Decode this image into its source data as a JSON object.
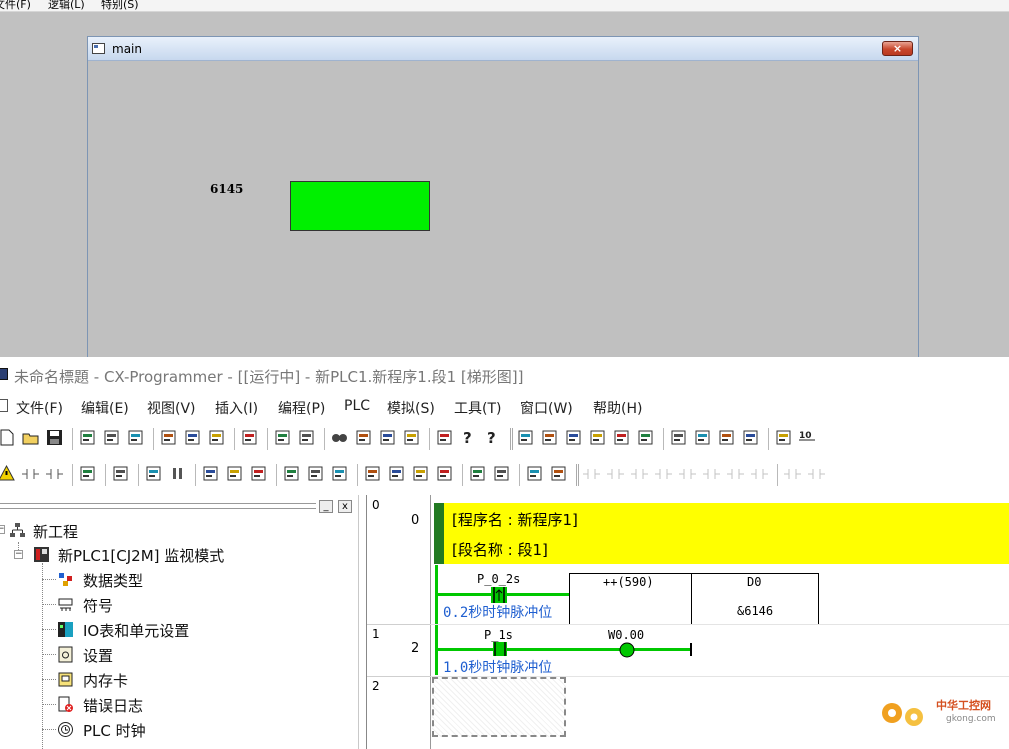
{
  "top_app": {
    "menu": [
      "文件(F)",
      "逻辑(L)",
      "特别(S)"
    ],
    "window_title": "main",
    "close_label": "×",
    "value_label": "6145",
    "indicator_color": "#00f000"
  },
  "cx": {
    "title": "未命名標題 - CX-Programmer - [[运行中] - 新PLC1.新程序1.段1 [梯形图]]",
    "menu": [
      "文件(F)",
      "编辑(E)",
      "视图(V)",
      "插入(I)",
      "编程(P)",
      "PLC",
      "模拟(S)",
      "工具(T)",
      "窗口(W)",
      "帮助(H)"
    ],
    "toolbar1_icons": [
      "new-icon",
      "open-icon",
      "save-icon",
      "print-preview-icon",
      "print-icon",
      "preview-icon",
      "cut-icon",
      "copy-icon",
      "paste-icon",
      "paste-special-icon",
      "undo-icon",
      "redo-icon",
      "find-icon",
      "replace-icon",
      "cross-ref-icon",
      "address-icon",
      "properties-icon",
      "help-icon",
      "context-help-icon",
      "ladder-view-icon",
      "mnemonic-view-icon",
      "monitor-icon",
      "watch-icon",
      "io-table-icon",
      "settings-icon",
      "symbol-table-icon",
      "program-icon",
      "function-block-icon",
      "memory-icon",
      "grid-icon",
      "radix-icon"
    ],
    "toolbar2_icons": [
      "warning-online-icon",
      "online-icon",
      "online-sim-icon",
      "transfer-icon",
      "monitor-mode-icon",
      "run-icon",
      "pause-icon",
      "upload-icon",
      "download-icon",
      "compare-icon",
      "force-on-icon",
      "force-off-icon",
      "force-cancel-icon",
      "screen-monitor-icon",
      "time-chart-icon",
      "data-trace-icon",
      "data-trace2-icon",
      "plc-info-icon",
      "cycle-time-icon",
      "sim-start-icon",
      "sim-stop-icon",
      "contact-no-icon",
      "contact-nc-icon",
      "contact-or-icon",
      "contact-or-nc-icon",
      "vline-icon",
      "hline-icon",
      "coil-icon",
      "coil-nc-icon",
      "instruction-icon",
      "jump-icon"
    ],
    "tree": {
      "items": [
        {
          "label": "新工程",
          "icon": "project-icon"
        },
        {
          "label": "新PLC1[CJ2M] 监视模式",
          "icon": "plc-icon"
        },
        {
          "label": "数据类型",
          "icon": "data-type-icon"
        },
        {
          "label": "符号",
          "icon": "symbol-icon"
        },
        {
          "label": "IO表和单元设置",
          "icon": "io-table-icon"
        },
        {
          "label": "设置",
          "icon": "settings-icon"
        },
        {
          "label": "内存卡",
          "icon": "memory-card-icon"
        },
        {
          "label": "错误日志",
          "icon": "error-log-icon"
        },
        {
          "label": "PLC 时钟",
          "icon": "plc-clock-icon"
        }
      ],
      "header_buttons": [
        "_",
        "x"
      ]
    },
    "ladder": {
      "rungs": [
        {
          "rung": "0",
          "step": "0"
        },
        {
          "rung": "1",
          "step": "2"
        },
        {
          "rung": "2",
          "step": ""
        }
      ],
      "header_program": "[程序名 : 新程序1]",
      "header_section": "[段名称 : 段1]",
      "rung1": {
        "contact": "P_0_2s",
        "contact_comment": "0.2秒时钟脉冲位",
        "instruction": "++(590)",
        "operand": "D0",
        "operand_value": "&6146"
      },
      "rung2": {
        "contact": "P_1s",
        "contact_comment": "1.0秒时钟脉冲位",
        "coil": "W0.00"
      },
      "energized_color": "#00c800"
    },
    "watermark_text": "中华工控网",
    "watermark_url": "gkong.com"
  }
}
